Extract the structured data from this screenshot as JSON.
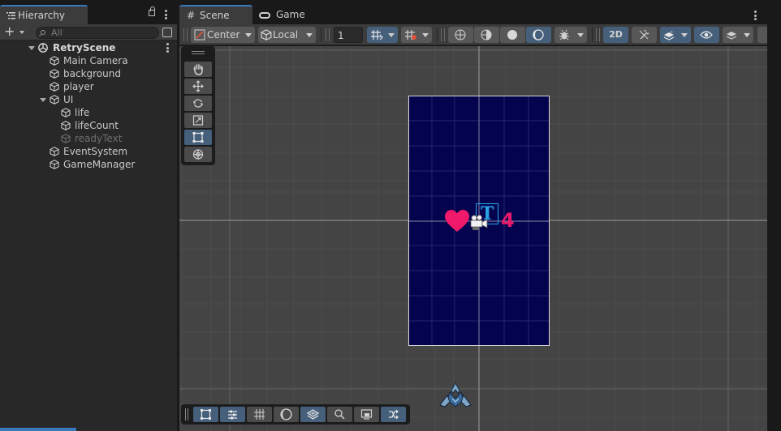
{
  "hierarchy": {
    "tab_label": "Hierarchy",
    "search_placeholder": "All",
    "scene_name": "RetryScene",
    "items": [
      {
        "label": "Main Camera"
      },
      {
        "label": "background"
      },
      {
        "label": "player"
      },
      {
        "label": "UI"
      },
      {
        "label": "life"
      },
      {
        "label": "lifeCount"
      },
      {
        "label": "readyText"
      },
      {
        "label": "EventSystem"
      },
      {
        "label": "GameManager"
      }
    ]
  },
  "scene": {
    "tabs": [
      {
        "label": "Scene"
      },
      {
        "label": "Game"
      }
    ],
    "toolbar": {
      "pivot_mode": "Center",
      "pivot_rotation": "Local",
      "grid_size": "1",
      "mode_2d": "2D"
    },
    "life_count_text": "4"
  },
  "colors": {
    "accent": "#3a79bb",
    "canvas": "#04034e",
    "heart": "#f0196a",
    "text_icon": "#2aa6e8",
    "active_toggle": "#46607c"
  }
}
